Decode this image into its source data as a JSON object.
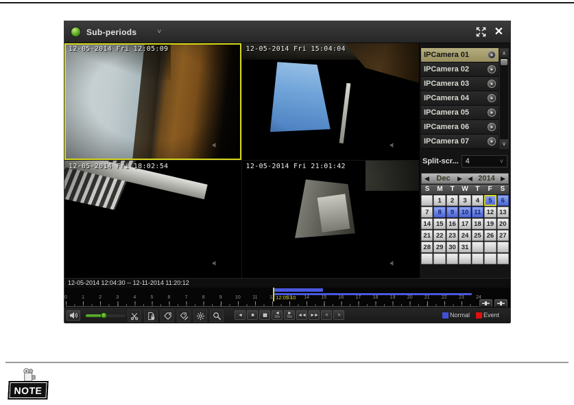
{
  "titlebar": {
    "mode_label": "Sub-periods",
    "dropdown_glyph": "˅",
    "close_glyph": "✕"
  },
  "videos": [
    {
      "timestamp": "12-05-2014 Fri 12:05:09",
      "selected": true
    },
    {
      "timestamp": "12-05-2014 Fri 15:04:04",
      "selected": false
    },
    {
      "timestamp": "12-05-2014 Fri 18:02:54",
      "selected": false
    },
    {
      "timestamp": "12-05-2014 Fri 21:01:42",
      "selected": false
    }
  ],
  "camera_list": {
    "items": [
      {
        "name": "IPCamera 01",
        "selected": true
      },
      {
        "name": "IPCamera 02",
        "selected": false
      },
      {
        "name": "IPCamera 03",
        "selected": false
      },
      {
        "name": "IPCamera 04",
        "selected": false
      },
      {
        "name": "IPCamera 05",
        "selected": false
      },
      {
        "name": "IPCamera 06",
        "selected": false
      },
      {
        "name": "IPCamera 07",
        "selected": false
      }
    ],
    "scroll_up_glyph": "∧",
    "scroll_down_glyph": "∨",
    "selected_row_color": "#a89f6e"
  },
  "split_screen": {
    "label": "Split-scr...",
    "value": "4",
    "dropdown_glyph": "˅"
  },
  "calendar": {
    "prev_glyph": "◀",
    "next_glyph": "▶",
    "month": "Dec",
    "year": "2014",
    "day_headers": [
      "S",
      "M",
      "T",
      "W",
      "T",
      "F",
      "S"
    ],
    "weeks": [
      [
        "",
        1,
        2,
        3,
        4,
        5,
        6
      ],
      [
        7,
        8,
        9,
        10,
        11,
        12,
        13
      ],
      [
        14,
        15,
        16,
        17,
        18,
        19,
        20
      ],
      [
        21,
        22,
        23,
        24,
        25,
        26,
        27
      ],
      [
        28,
        29,
        30,
        31,
        "",
        "",
        ""
      ],
      [
        "",
        "",
        "",
        "",
        "",
        "",
        ""
      ]
    ],
    "recording_days": [
      5,
      6,
      8,
      9,
      10,
      11
    ],
    "selected_day": 5,
    "recording_day_color": "#4d66d4",
    "selected_border_color": "#e8e838"
  },
  "timeline": {
    "range_text": "12-05-2014 12:04:30 -- 12-11-2014 11:20:12",
    "cursor_label": "12:05:10",
    "cursor_hour": 12.086,
    "cursor_color": "#d8d820",
    "bar_color": "#4a58e0",
    "bars": [
      {
        "start_hour": 12.05,
        "end_hour": 14.95
      },
      {
        "start_hour": 12.1,
        "end_hour": 23.6
      }
    ],
    "hour_labels": [
      "0",
      "1",
      "2",
      "3",
      "4",
      "5",
      "6",
      "7",
      "8",
      "9",
      "10",
      "11",
      "12",
      "13",
      "14",
      "15",
      "16",
      "17",
      "18",
      "19",
      "20",
      "21",
      "22",
      "23",
      "24"
    ]
  },
  "controls": {
    "volume_percent": 45,
    "tools": [
      "clip-icon",
      "lock-file-icon",
      "add-tag-icon",
      "add-custom-tag-icon",
      "tag-management-icon",
      "digital-zoom-icon"
    ],
    "transport": [
      {
        "name": "reverse-play",
        "glyph": "◄"
      },
      {
        "name": "stop",
        "glyph": "■"
      },
      {
        "name": "pause",
        "glyph": "▮▮"
      },
      {
        "name": "back-30s",
        "glyph": "◄",
        "sub": "30s"
      },
      {
        "name": "forward-30s",
        "glyph": "►",
        "sub": "30s"
      },
      {
        "name": "slow-down",
        "glyph": "◄◄"
      },
      {
        "name": "speed-up",
        "glyph": "►►"
      },
      {
        "name": "previous-file",
        "glyph": "<"
      },
      {
        "name": "next-file",
        "glyph": ">"
      }
    ]
  },
  "legend": {
    "normal_label": "Normal",
    "normal_color": "#4050d8",
    "event_label": "Event",
    "event_color": "#e01010"
  },
  "note": {
    "label": "NOTE"
  }
}
